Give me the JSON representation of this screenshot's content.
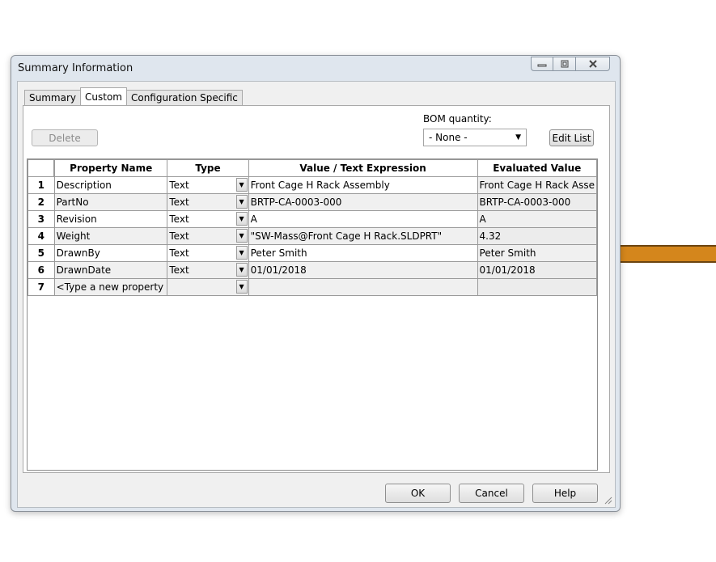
{
  "window": {
    "title": "Summary Information"
  },
  "tabs": [
    {
      "label": "Summary",
      "active": false
    },
    {
      "label": "Custom",
      "active": true
    },
    {
      "label": "Configuration Specific",
      "active": false
    }
  ],
  "toolbar": {
    "delete_label": "Delete",
    "bom_label": "BOM quantity:",
    "bom_value": "- None -",
    "edit_list_label": "Edit List"
  },
  "grid": {
    "headers": {
      "property": "Property Name",
      "type": "Type",
      "value": "Value / Text Expression",
      "evaluated": "Evaluated Value"
    },
    "rows": [
      {
        "num": "1",
        "name": "Description",
        "type": "Text",
        "value": "Front Cage H  Rack Assembly",
        "evaluated": "Front Cage H  Rack Asse"
      },
      {
        "num": "2",
        "name": "PartNo",
        "type": "Text",
        "value": "BRTP-CA-0003-000",
        "evaluated": "BRTP-CA-0003-000"
      },
      {
        "num": "3",
        "name": "Revision",
        "type": "Text",
        "value": "A",
        "evaluated": "A"
      },
      {
        "num": "4",
        "name": "Weight",
        "type": "Text",
        "value": "\"SW-Mass@Front Cage H  Rack.SLDPRT\"",
        "evaluated": "4.32"
      },
      {
        "num": "5",
        "name": "DrawnBy",
        "type": "Text",
        "value": "Peter Smith",
        "evaluated": "Peter Smith"
      },
      {
        "num": "6",
        "name": "DrawnDate",
        "type": "Text",
        "value": "01/01/2018",
        "evaluated": "01/01/2018"
      },
      {
        "num": "7",
        "name": "<Type a new property",
        "type": "",
        "value": "",
        "evaluated": ""
      }
    ]
  },
  "footer": {
    "ok_label": "OK",
    "cancel_label": "Cancel",
    "help_label": "Help"
  }
}
